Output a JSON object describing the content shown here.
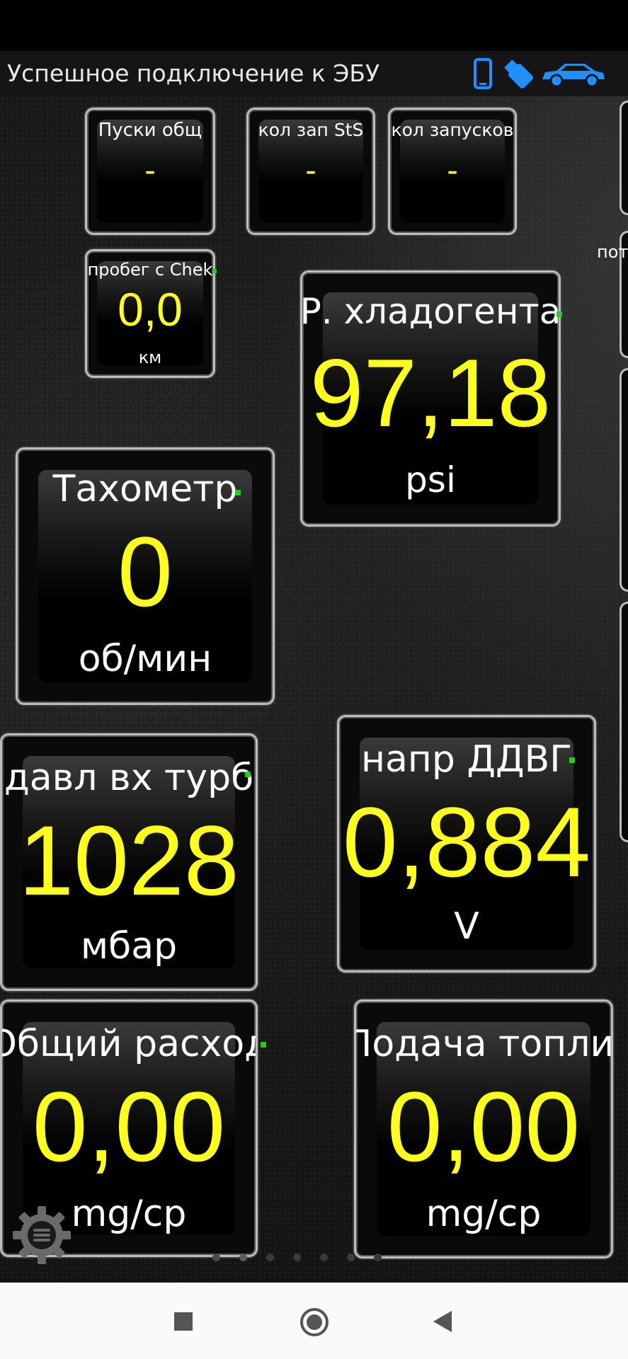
{
  "header": {
    "status_text": "Успешное подключение к ЭБУ",
    "icons": [
      "phone-icon",
      "usb-dongle-icon",
      "car-icon"
    ],
    "icon_color": "#1e90ff"
  },
  "gauges": {
    "starts_total": {
      "label": "Пуски общ",
      "value": "-"
    },
    "sts_starts": {
      "label": "кол зап StS",
      "value": "-"
    },
    "starts_count": {
      "label": "кол запусков",
      "value": "-"
    },
    "mileage_check": {
      "label": "пробег с Chek",
      "value": "0,0",
      "unit": "км"
    },
    "refrigerant_pressure": {
      "label": "Р. хладогента",
      "value": "97,18",
      "unit": "psi"
    },
    "tachometer": {
      "label": "Тахометр",
      "value": "0",
      "unit": "об/мин"
    },
    "turbo_inlet_pressure": {
      "label": "давл вх турб",
      "value": "1028",
      "unit": "мбар"
    },
    "ddvg_voltage": {
      "label": "напр ДДВГ",
      "value": "0,884",
      "unit": "V"
    },
    "total_consumption": {
      "label": "Общий расход",
      "value": "0,00",
      "unit": "mg/cp"
    },
    "fuel_supply": {
      "label": "Подача топлива",
      "value": "0,00",
      "unit": "mg/cp"
    }
  },
  "edge": {
    "partial_label": "пот"
  },
  "colors": {
    "value": "#ffff1a",
    "label": "#ffffff",
    "indicator": "#22cc22",
    "frame": "#bdbdbd"
  },
  "nav": {
    "buttons": [
      "recents-square-icon",
      "home-circle-icon",
      "back-triangle-icon"
    ]
  }
}
